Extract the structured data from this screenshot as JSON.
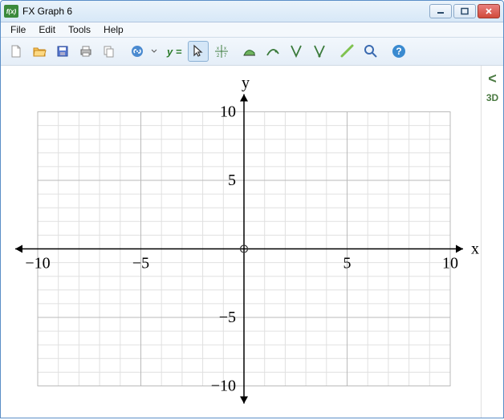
{
  "window": {
    "title": "FX Graph 6",
    "app_icon_text": "f(x)"
  },
  "menu": {
    "file": "File",
    "edit": "Edit",
    "tools": "Tools",
    "help": "Help"
  },
  "toolbar": {
    "equation_prefix": "y ="
  },
  "side": {
    "expand": "<",
    "mode3d": "3D"
  },
  "chart_data": {
    "type": "scatter",
    "title": "",
    "xlabel": "x",
    "ylabel": "y",
    "xlim": [
      -10,
      10
    ],
    "ylim": [
      -10,
      10
    ],
    "x_ticks": [
      -10,
      -5,
      5,
      10
    ],
    "y_ticks": [
      -10,
      -5,
      5,
      10
    ],
    "minor_step": 1,
    "major_step": 5,
    "series": []
  }
}
